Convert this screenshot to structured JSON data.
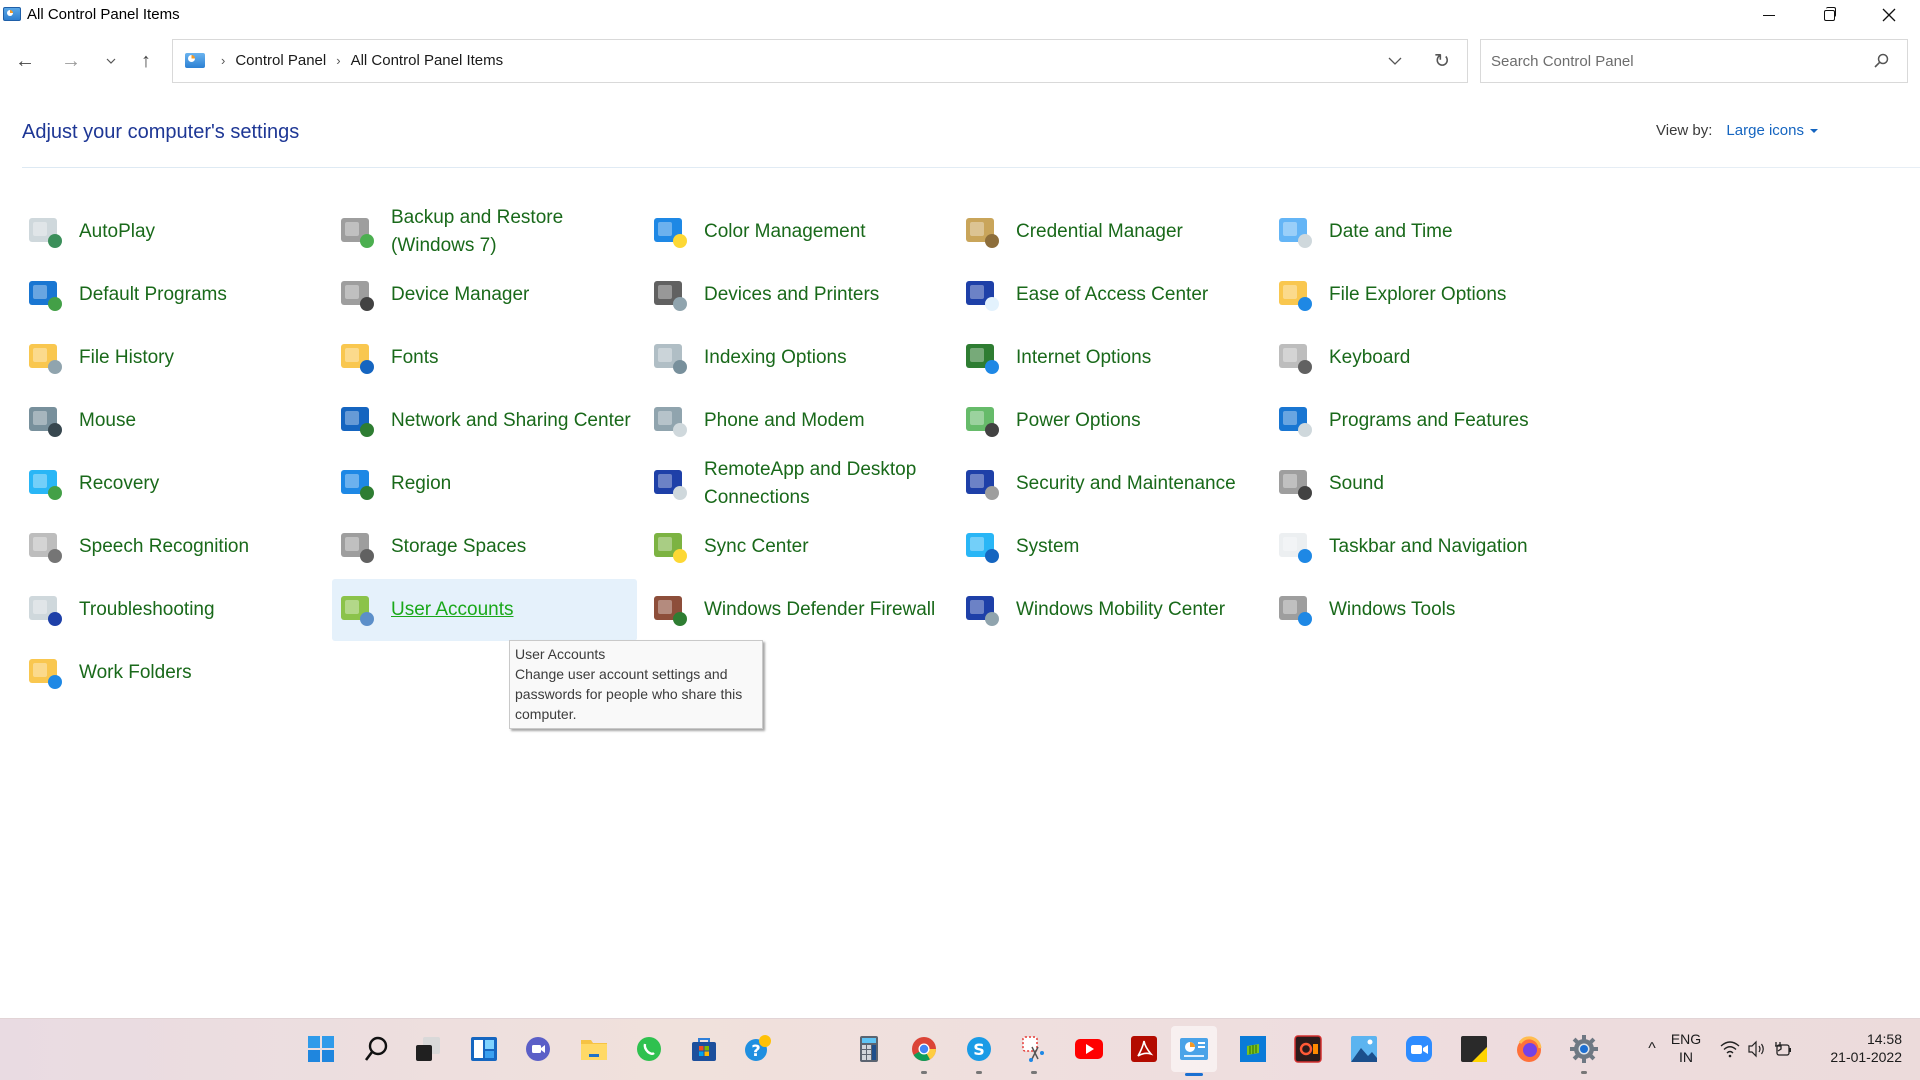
{
  "window": {
    "title": "All Control Panel Items",
    "minimize_label": "Minimize",
    "maximize_label": "Restore",
    "close_label": "Close"
  },
  "nav": {
    "back": "←",
    "forward": "→",
    "recent": "⌄",
    "up": "↑"
  },
  "address": {
    "breadcrumb": [
      "Control Panel",
      "All Control Panel Items"
    ],
    "separator": "›",
    "dropdown": "⌄",
    "refresh": "↻"
  },
  "search": {
    "placeholder": "Search Control Panel",
    "value": ""
  },
  "header": {
    "title": "Adjust your computer's settings",
    "view_by_label": "View by:",
    "view_by_value": "Large icons"
  },
  "items": [
    {
      "label": "AutoPlay",
      "icon": "autoplay-icon"
    },
    {
      "label": "Backup and Restore (Windows 7)",
      "icon": "backup-restore-icon"
    },
    {
      "label": "Color Management",
      "icon": "color-management-icon"
    },
    {
      "label": "Credential Manager",
      "icon": "credential-manager-icon"
    },
    {
      "label": "Date and Time",
      "icon": "date-time-icon"
    },
    {
      "label": "Default Programs",
      "icon": "default-programs-icon"
    },
    {
      "label": "Device Manager",
      "icon": "device-manager-icon"
    },
    {
      "label": "Devices and Printers",
      "icon": "devices-printers-icon"
    },
    {
      "label": "Ease of Access Center",
      "icon": "ease-of-access-icon"
    },
    {
      "label": "File Explorer Options",
      "icon": "file-explorer-options-icon"
    },
    {
      "label": "File History",
      "icon": "file-history-icon"
    },
    {
      "label": "Fonts",
      "icon": "fonts-icon"
    },
    {
      "label": "Indexing Options",
      "icon": "indexing-options-icon"
    },
    {
      "label": "Internet Options",
      "icon": "internet-options-icon"
    },
    {
      "label": "Keyboard",
      "icon": "keyboard-icon"
    },
    {
      "label": "Mouse",
      "icon": "mouse-icon"
    },
    {
      "label": "Network and Sharing Center",
      "icon": "network-sharing-icon"
    },
    {
      "label": "Phone and Modem",
      "icon": "phone-modem-icon"
    },
    {
      "label": "Power Options",
      "icon": "power-options-icon"
    },
    {
      "label": "Programs and Features",
      "icon": "programs-features-icon"
    },
    {
      "label": "Recovery",
      "icon": "recovery-icon"
    },
    {
      "label": "Region",
      "icon": "region-icon"
    },
    {
      "label": "RemoteApp and Desktop Connections",
      "icon": "remoteapp-icon"
    },
    {
      "label": "Security and Maintenance",
      "icon": "security-maintenance-icon"
    },
    {
      "label": "Sound",
      "icon": "sound-icon"
    },
    {
      "label": "Speech Recognition",
      "icon": "speech-recognition-icon"
    },
    {
      "label": "Storage Spaces",
      "icon": "storage-spaces-icon"
    },
    {
      "label": "Sync Center",
      "icon": "sync-center-icon"
    },
    {
      "label": "System",
      "icon": "system-icon"
    },
    {
      "label": "Taskbar and Navigation",
      "icon": "taskbar-navigation-icon"
    },
    {
      "label": "Troubleshooting",
      "icon": "troubleshooting-icon"
    },
    {
      "label": "User Accounts",
      "icon": "user-accounts-icon",
      "hovered": true
    },
    {
      "label": "Windows Defender Firewall",
      "icon": "firewall-icon"
    },
    {
      "label": "Windows Mobility Center",
      "icon": "mobility-center-icon"
    },
    {
      "label": "Windows Tools",
      "icon": "windows-tools-icon"
    },
    {
      "label": "Work Folders",
      "icon": "work-folders-icon"
    }
  ],
  "tooltip": {
    "title": "User Accounts",
    "description": "Change user account settings and passwords for people who share this computer."
  },
  "taskbar": {
    "apps": [
      {
        "name": "start",
        "icon": "windows-start-icon"
      },
      {
        "name": "search",
        "icon": "search-icon"
      },
      {
        "name": "task-view",
        "icon": "task-view-icon"
      },
      {
        "name": "widgets",
        "icon": "widgets-icon"
      },
      {
        "name": "chat",
        "icon": "chat-icon"
      },
      {
        "name": "file-explorer",
        "icon": "folder-icon"
      },
      {
        "name": "whatsapp",
        "icon": "whatsapp-icon"
      },
      {
        "name": "microsoft-store",
        "icon": "store-icon"
      },
      {
        "name": "get-help",
        "icon": "help-icon"
      },
      {
        "name": "calculator",
        "icon": "calculator-icon"
      },
      {
        "name": "chrome",
        "icon": "chrome-icon",
        "running": true
      },
      {
        "name": "skype",
        "icon": "skype-icon",
        "running": true
      },
      {
        "name": "snipping-tool",
        "icon": "snipping-tool-icon",
        "running": true
      },
      {
        "name": "youtube",
        "icon": "youtube-icon"
      },
      {
        "name": "acrobat",
        "icon": "acrobat-icon"
      },
      {
        "name": "control-panel",
        "icon": "control-panel-icon",
        "active": true
      },
      {
        "name": "app-green",
        "icon": "green-app-icon"
      },
      {
        "name": "screen-recorder",
        "icon": "recorder-icon"
      },
      {
        "name": "photos",
        "icon": "photos-icon"
      },
      {
        "name": "zoom",
        "icon": "zoom-icon"
      },
      {
        "name": "sticky-notes",
        "icon": "sticky-notes-icon"
      },
      {
        "name": "firefox",
        "icon": "firefox-icon"
      },
      {
        "name": "settings",
        "icon": "settings-gear-icon",
        "running": true
      }
    ],
    "tray": {
      "overflow": "^",
      "language_line1": "ENG",
      "language_line2": "IN",
      "time": "14:58",
      "date": "21-01-2022"
    }
  },
  "colors": {
    "item_text": "#19691a",
    "item_text_hover": "#1aa81a",
    "hover_background": "#e5f1fb",
    "heading": "#1e3795",
    "link_blue": "#1565c0",
    "active_indicator": "#1a6fd1"
  }
}
